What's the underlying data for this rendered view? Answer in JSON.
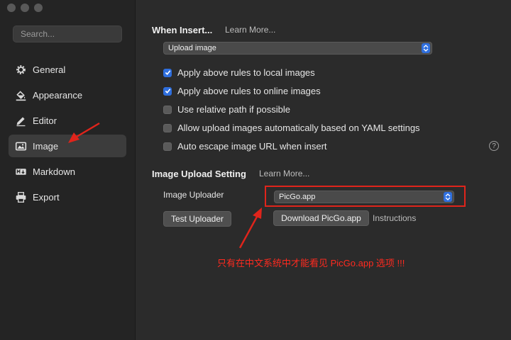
{
  "sidebar": {
    "search_placeholder": "Search...",
    "items": [
      {
        "label": "General",
        "icon": "gear-icon"
      },
      {
        "label": "Appearance",
        "icon": "paint-bucket-icon"
      },
      {
        "label": "Editor",
        "icon": "pencil-icon"
      },
      {
        "label": "Image",
        "icon": "image-icon"
      },
      {
        "label": "Markdown",
        "icon": "markdown-icon"
      },
      {
        "label": "Export",
        "icon": "printer-icon"
      }
    ],
    "active": "Image"
  },
  "when_insert": {
    "title": "When Insert...",
    "learn_more": "Learn More...",
    "select_value": "Upload image"
  },
  "options": [
    {
      "label": "Apply above rules to local images",
      "checked": true
    },
    {
      "label": "Apply above rules to online images",
      "checked": true
    },
    {
      "label": "Use relative path if possible",
      "checked": false
    },
    {
      "label": "Allow upload images automatically based on YAML settings",
      "checked": false
    },
    {
      "label": "Auto escape image URL when insert",
      "checked": false
    }
  ],
  "help_icon": "?",
  "upload_setting": {
    "title": "Image Upload Setting",
    "learn_more": "Learn More...",
    "uploader_label": "Image Uploader",
    "uploader_value": "PicGo.app",
    "test_button": "Test Uploader",
    "download_button": "Download PicGo.app",
    "instructions": "Instructions"
  },
  "annotation": {
    "note": "只有在中文系统中才能看见 PicGo.app 选项 !!!",
    "color": "#ff2a1f"
  },
  "colors": {
    "accent": "#2f6fde",
    "sidebar_bg": "#242424",
    "main_bg": "#2b2b2b",
    "annotation_red": "#e0241b"
  }
}
